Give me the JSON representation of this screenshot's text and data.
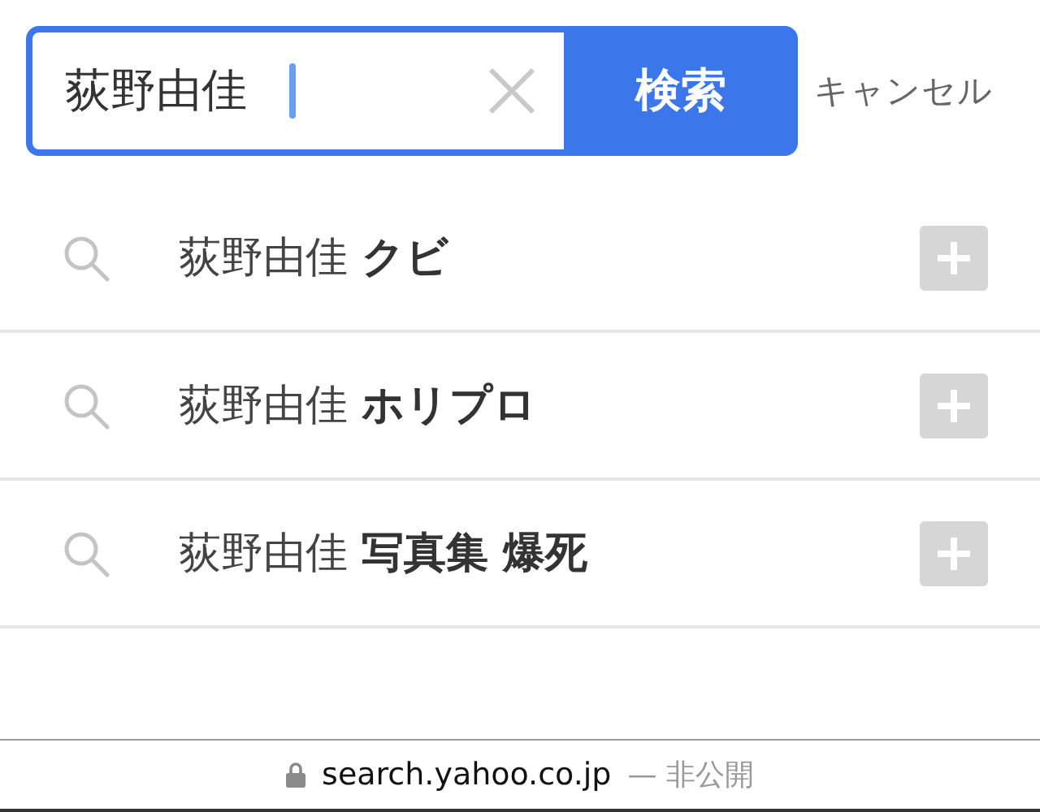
{
  "search": {
    "value": "荻野由佳",
    "button": "検索",
    "cancel": "キャンセル"
  },
  "suggestions": [
    {
      "text": "荻野由佳 **クビ**"
    },
    {
      "text": "荻野由佳 **ホリプロ**"
    },
    {
      "text": "荻野由佳 **写真集 爆死**"
    }
  ],
  "status_bar": {
    "url": "search.yahoo.co.jp",
    "privacy": "— 非公開"
  }
}
